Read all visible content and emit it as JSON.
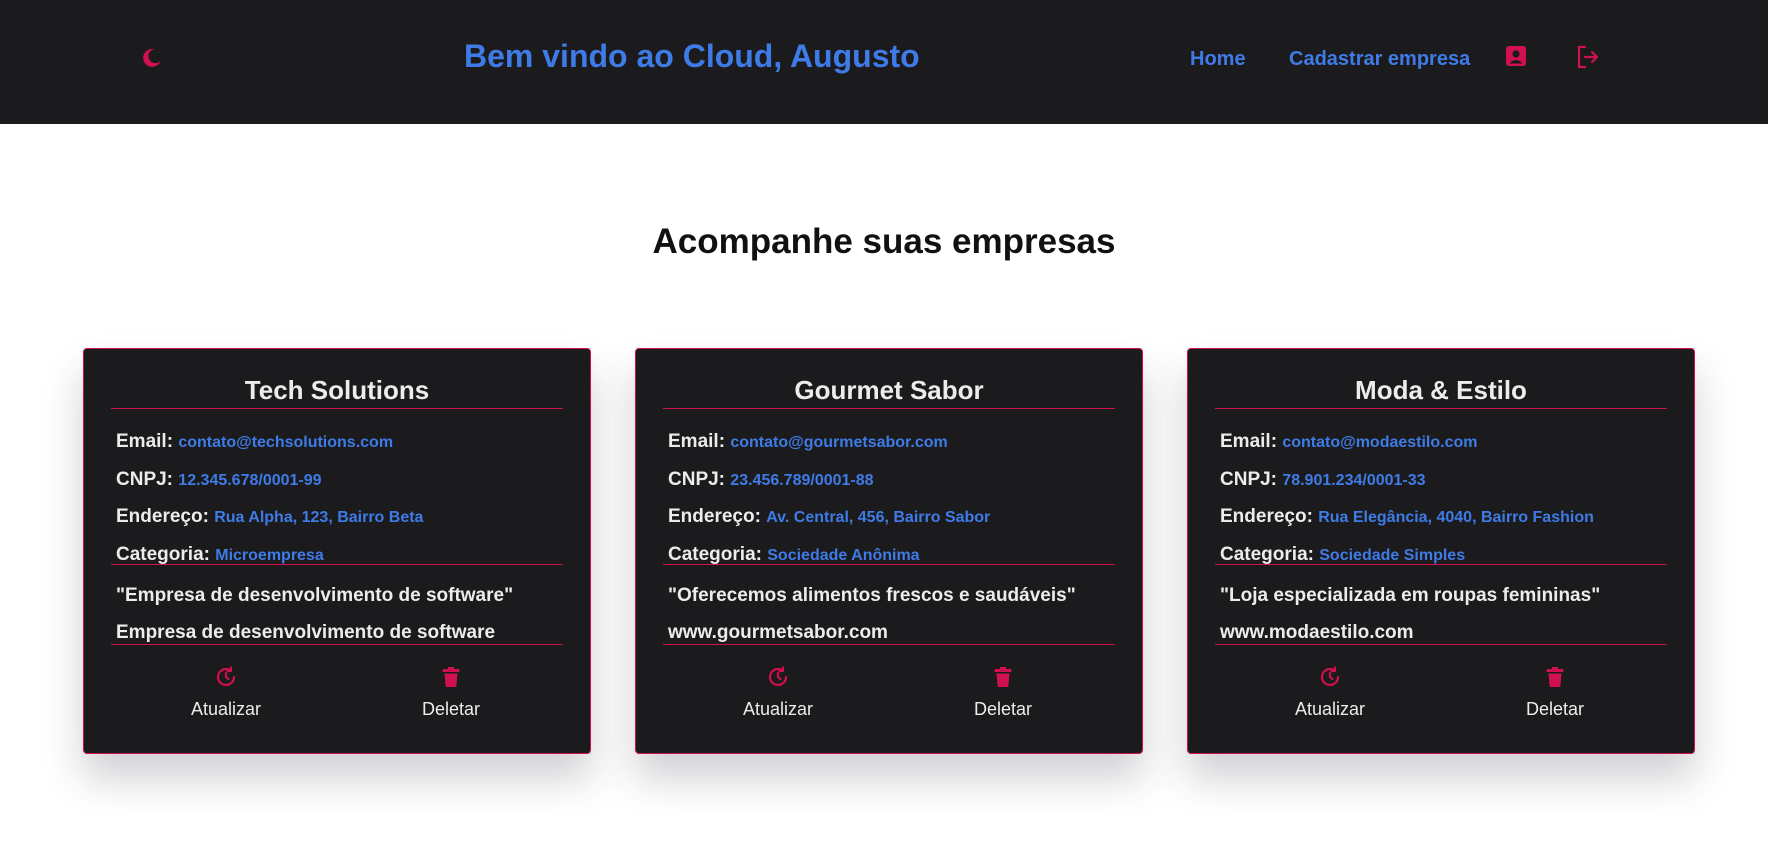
{
  "header": {
    "theme_icon": "moon-icon",
    "welcome": "Bem vindo ao Cloud, Augusto",
    "nav": {
      "home": "Home",
      "register_company": "Cadastrar empresa"
    },
    "profile_icon": "user-icon",
    "logout_icon": "logout-icon"
  },
  "main": {
    "heading": "Acompanhe suas empresas"
  },
  "labels": {
    "email": "Email:",
    "cnpj": "CNPJ:",
    "address": "Endereço:",
    "category": "Categoria:",
    "update": "Atualizar",
    "delete": "Deletar"
  },
  "companies": [
    {
      "name": "Tech Solutions",
      "email": "contato@techsolutions.com",
      "cnpj": "12.345.678/0001-99",
      "address": "Rua Alpha, 123, Bairro Beta",
      "category": "Microempresa",
      "slogan": "\"Empresa de desenvolvimento de software\"",
      "extra": "Empresa de desenvolvimento de software"
    },
    {
      "name": "Gourmet Sabor",
      "email": "contato@gourmetsabor.com",
      "cnpj": "23.456.789/0001-88",
      "address": "Av. Central, 456, Bairro Sabor",
      "category": "Sociedade Anônima",
      "slogan": "\"Oferecemos alimentos frescos e saudáveis\"",
      "extra": "www.gourmetsabor.com"
    },
    {
      "name": "Moda & Estilo",
      "email": "contato@modaestilo.com",
      "cnpj": "78.901.234/0001-33",
      "address": "Rua Elegância, 4040, Bairro Fashion",
      "category": "Sociedade Simples",
      "slogan": "\"Loja especializada em roupas femininas\"",
      "extra": "www.modaestilo.com"
    }
  ],
  "colors": {
    "accent_pink": "#d01050",
    "link_blue": "#3f7be6",
    "dark_bg": "#1b1b1e",
    "card_text": "#ececec"
  },
  "icons": {
    "update": "refresh-icon",
    "delete": "trash-icon"
  }
}
